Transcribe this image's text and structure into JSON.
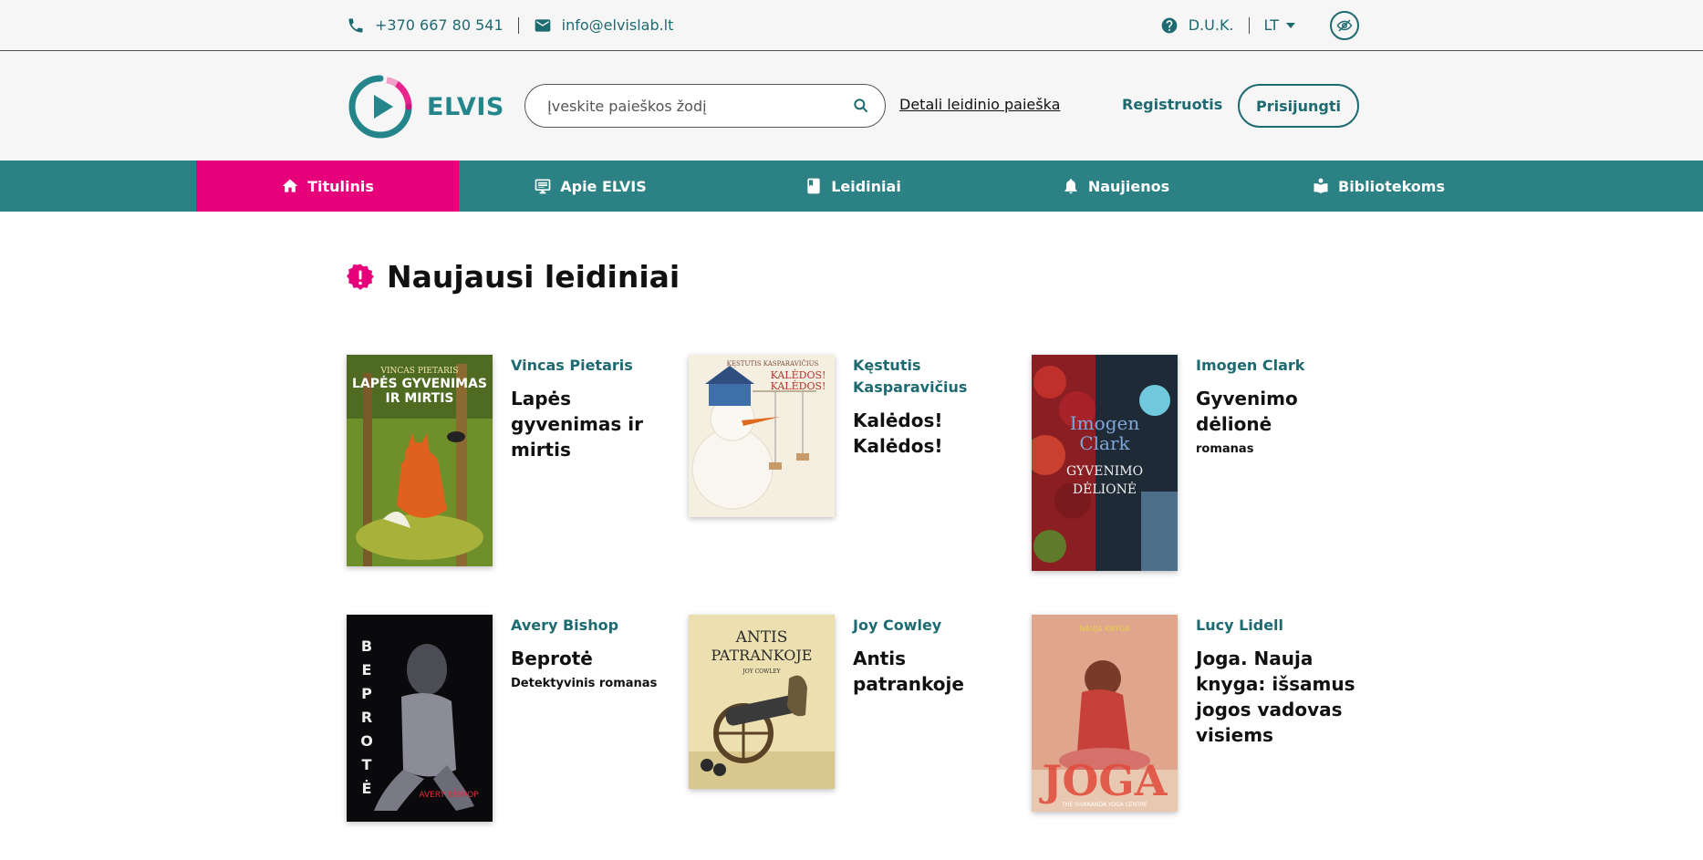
{
  "topbar": {
    "phone": "+370 667 80 541",
    "email": "info@elvislab.lt",
    "faq": "D.U.K.",
    "language": "LT"
  },
  "header": {
    "logo_text": "ELVIS",
    "search_placeholder": "Įveskite paieškos žodį",
    "advanced_search": "Detali leidinio paieška",
    "register": "Registruotis",
    "login": "Prisijungti"
  },
  "nav": {
    "items": [
      {
        "label": "Titulinis",
        "icon": "home-icon"
      },
      {
        "label": "Apie ELVIS",
        "icon": "text-box-icon"
      },
      {
        "label": "Leidiniai",
        "icon": "book-icon"
      },
      {
        "label": "Naujienos",
        "icon": "bell-icon"
      },
      {
        "label": "Bibliotekoms",
        "icon": "reader-icon"
      }
    ]
  },
  "main": {
    "section_title": "Naujausi leidiniai",
    "books": [
      {
        "author": "Vincas Pietaris",
        "title": "Lapės gyvenimas ir mirtis",
        "subtitle": ""
      },
      {
        "author": "Kęstutis Kasparavičius",
        "title": "Kalėdos! Kalėdos!",
        "subtitle": ""
      },
      {
        "author": "Imogen Clark",
        "title": "Gyvenimo dėlionė",
        "subtitle": "romanas"
      },
      {
        "author": "Avery Bishop",
        "title": "Beprotė",
        "subtitle": "Detektyvinis romanas"
      },
      {
        "author": "Joy Cowley",
        "title": "Antis patrankoje",
        "subtitle": ""
      },
      {
        "author": "Lucy Lidell",
        "title": "Joga. Nauja knyga: išsamus jogos vadovas visiems",
        "subtitle": ""
      }
    ]
  },
  "colors": {
    "teal": "#2c8185",
    "teal_dark": "#1d6a70",
    "magenta": "#e6007a"
  }
}
